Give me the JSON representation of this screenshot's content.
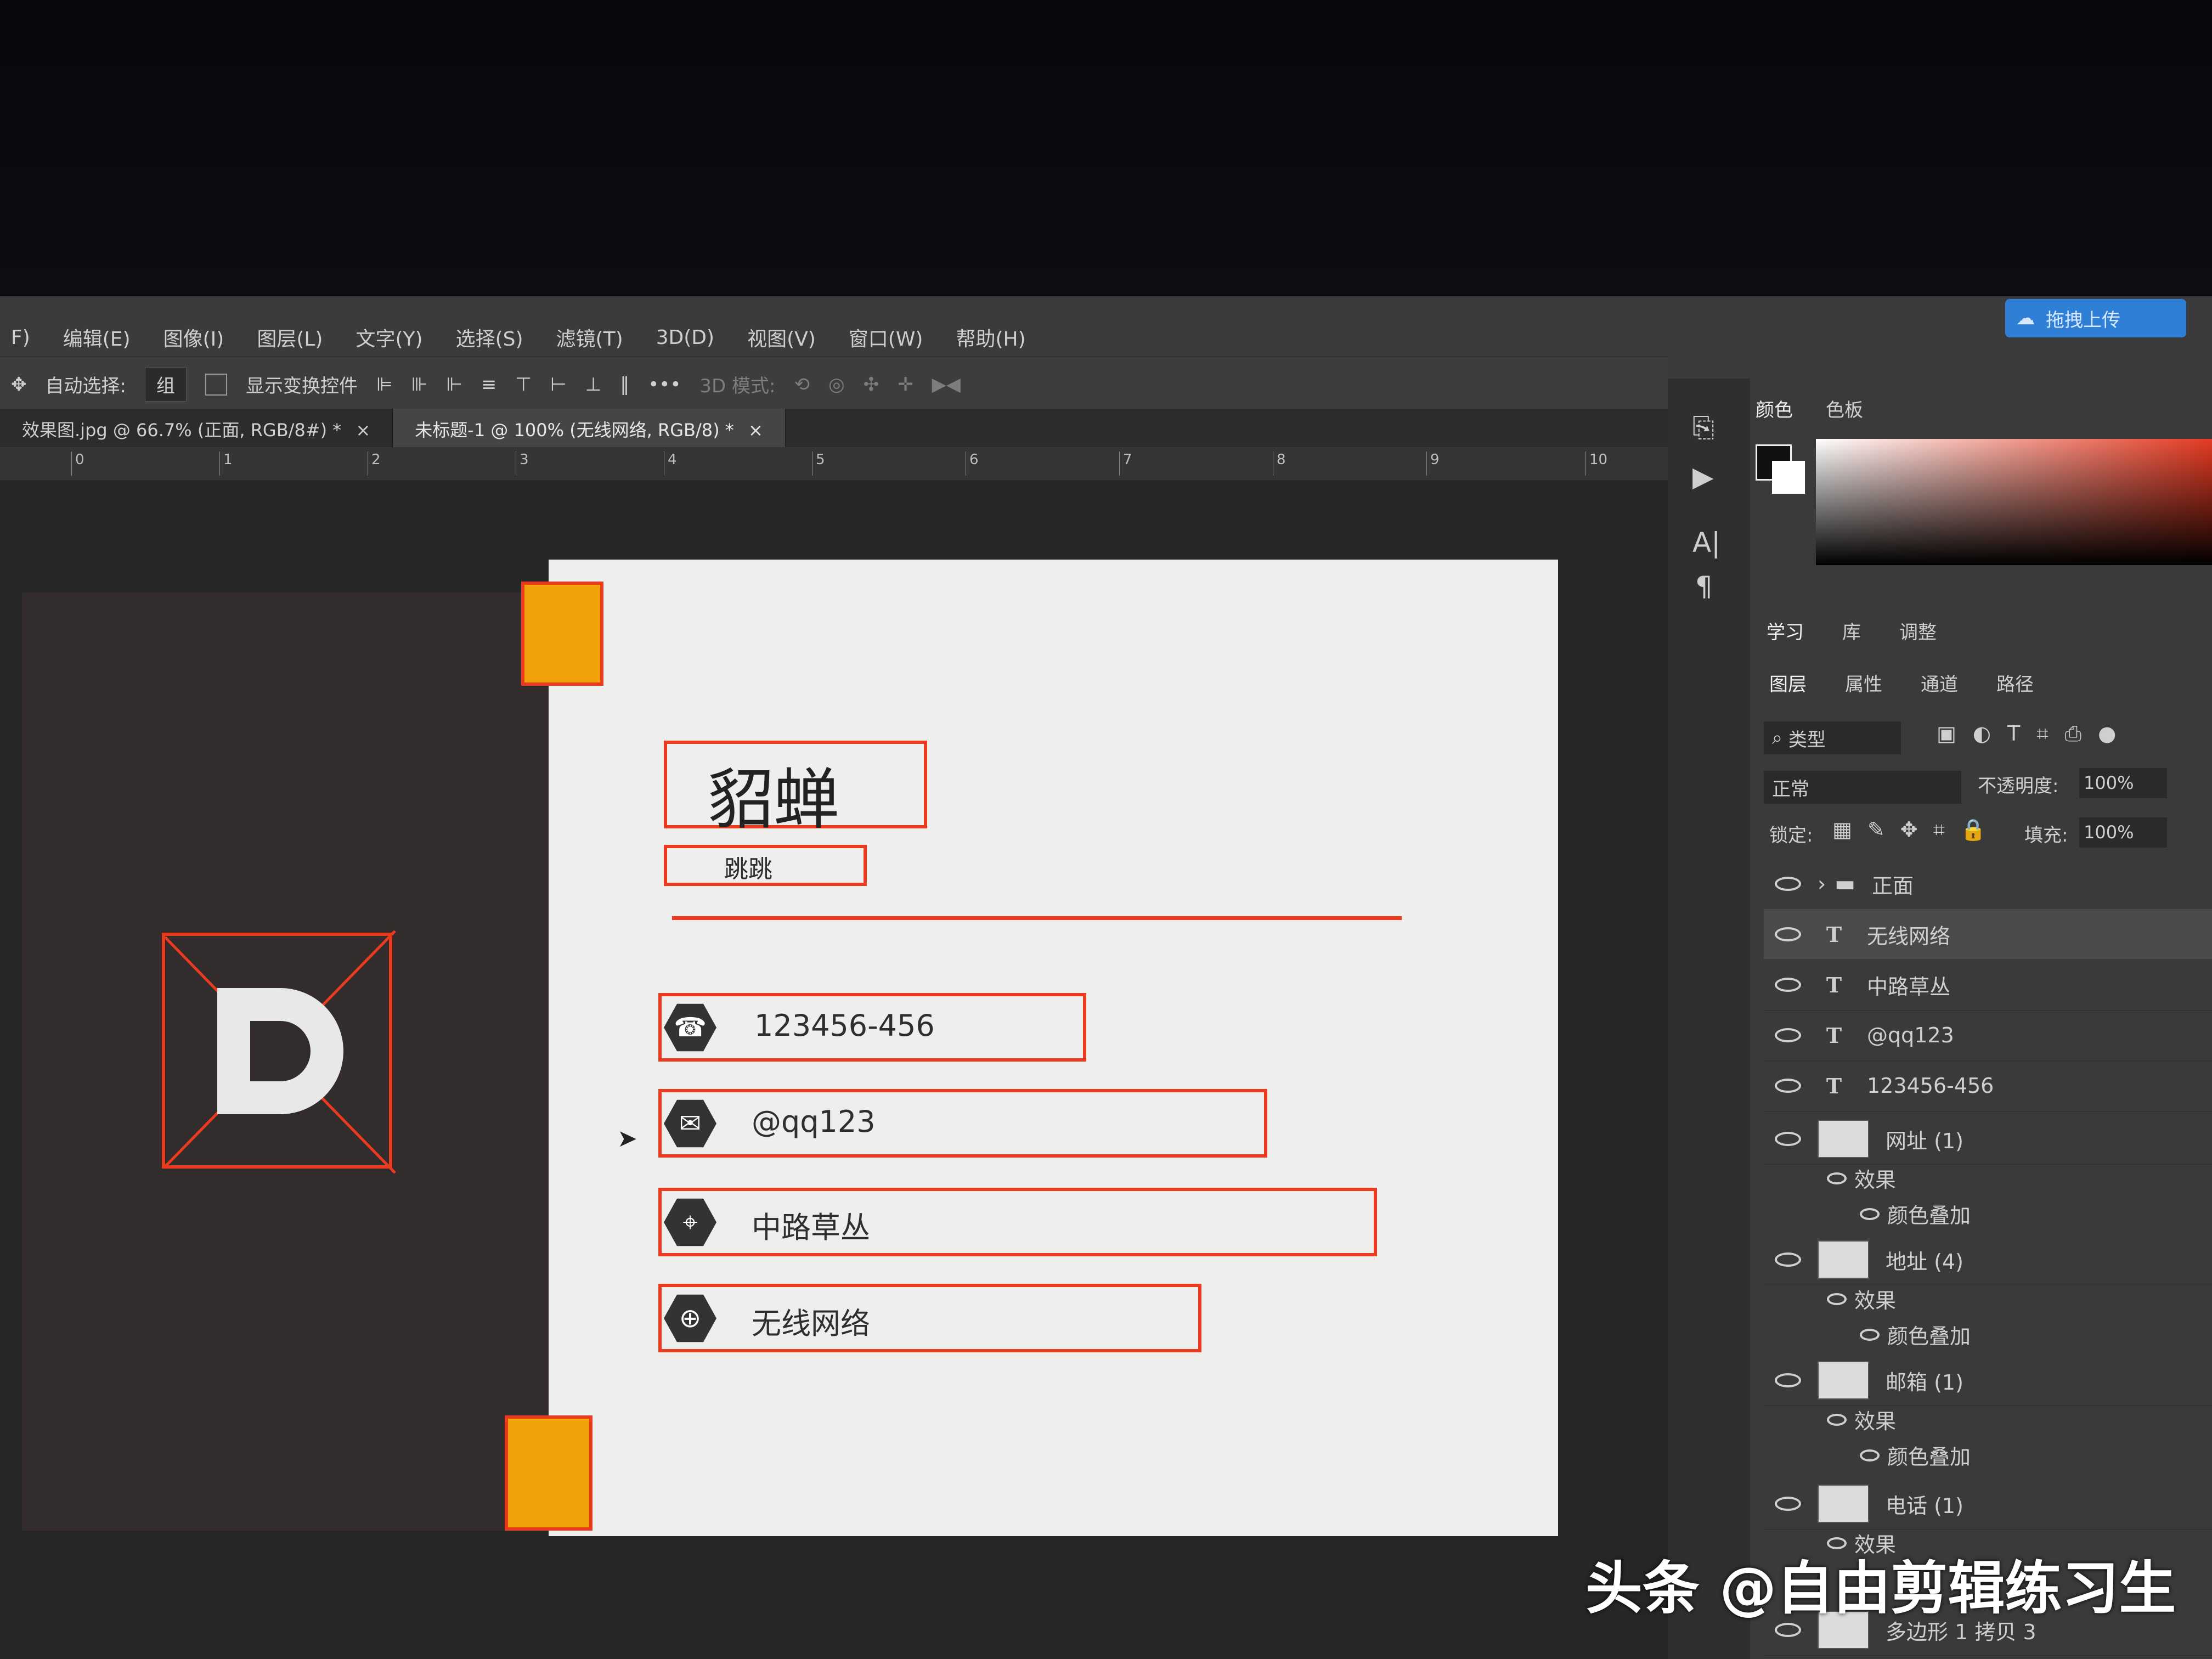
{
  "menu": [
    "F)",
    "编辑(E)",
    "图像(I)",
    "图层(L)",
    "文字(Y)",
    "选择(S)",
    "滤镜(T)",
    "3D(D)",
    "视图(V)",
    "窗口(W)",
    "帮助(H)"
  ],
  "cloud_button": "拖拽上传",
  "options": {
    "auto_select_label": "自动选择:",
    "auto_select_value": "组",
    "show_transform": "显示变换控件",
    "more": "•••",
    "mode_3d": "3D 模式:"
  },
  "tabs": [
    {
      "label": "效果图.jpg @ 66.7% (正面, RGB/8#) *",
      "close": "×"
    },
    {
      "label": "未标题-1 @ 100% (无线网络, RGB/8) *",
      "close": "×"
    }
  ],
  "ruler": [
    "0",
    "1",
    "2",
    "3",
    "4",
    "5",
    "6",
    "7",
    "8",
    "9",
    "10"
  ],
  "card": {
    "name": "貂蝉",
    "subtitle": "跳跳",
    "phone": "123456-456",
    "email": "@qq123",
    "address": "中路草丛",
    "web": "无线网络"
  },
  "color_panel": {
    "tabs": [
      "颜色",
      "色板"
    ]
  },
  "learn_tabs": [
    "学习",
    "库",
    "调整"
  ],
  "layer_panel": {
    "tabs": [
      "图层",
      "属性",
      "通道",
      "路径"
    ],
    "filter": "类型",
    "blend_mode": "正常",
    "opacity_label": "不透明度:",
    "opacity_value": "100%",
    "lock_label": "锁定:",
    "fill_label": "填充:",
    "fill_value": "100%",
    "layers": [
      {
        "name": "正面",
        "type": "folder"
      },
      {
        "name": "无线网络",
        "type": "text"
      },
      {
        "name": "中路草丛",
        "type": "text"
      },
      {
        "name": "@qq123",
        "type": "text"
      },
      {
        "name": "123456-456",
        "type": "text"
      },
      {
        "name": "网址 (1)",
        "type": "smart"
      },
      {
        "name": "地址 (4)",
        "type": "smart"
      },
      {
        "name": "邮箱 (1)",
        "type": "smart"
      },
      {
        "name": "电话 (1)",
        "type": "smart"
      },
      {
        "name": "多边形 1 拷贝 3",
        "type": "smart"
      }
    ],
    "effects_label": "效果",
    "color_overlay_label": "颜色叠加"
  },
  "watermark": "头条 @自由剪辑练习生",
  "colors": {
    "accent": "#ea3b1e",
    "orange": "#f1a10a",
    "card_bg": "#322c2d",
    "card_front": "#eeeeec"
  }
}
